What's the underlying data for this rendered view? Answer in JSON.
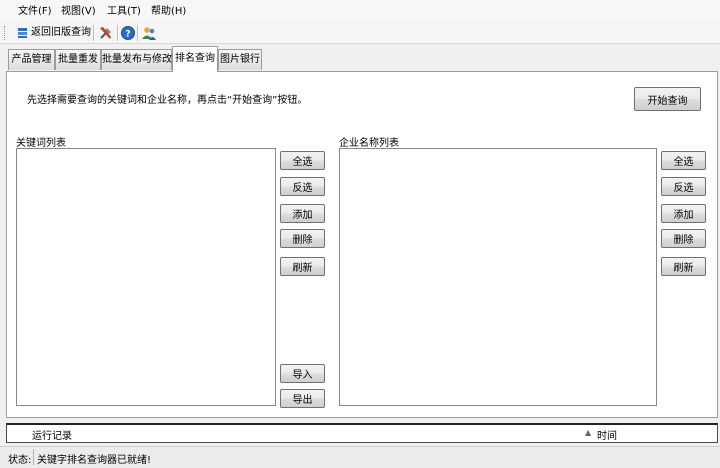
{
  "menu": {
    "items": [
      {
        "label": "文件(F)"
      },
      {
        "label": "视图(V)"
      },
      {
        "label": "工具(T)"
      },
      {
        "label": "帮助(H)"
      }
    ]
  },
  "toolbar": {
    "back_label": "返回旧版查询",
    "icons": [
      "return-icon",
      "tools-icon",
      "help-icon",
      "users-icon"
    ]
  },
  "tabs": [
    {
      "label": "产品管理",
      "active": false
    },
    {
      "label": "批量重发",
      "active": false
    },
    {
      "label": "批量发布与修改",
      "active": false
    },
    {
      "label": "排名查询",
      "active": true
    },
    {
      "label": "图片银行",
      "active": false
    }
  ],
  "rank_query": {
    "instruction": "先选择需要查询的关键词和企业名称，再点击“开始查询”按钮。",
    "start_button": "开始查询",
    "keywords": {
      "title": "关键词列表",
      "buttons": {
        "select_all": "全选",
        "invert": "反选",
        "add": "添加",
        "delete": "删除",
        "refresh": "刷新",
        "import": "导入",
        "export": "导出"
      }
    },
    "companies": {
      "title": "企业名称列表",
      "buttons": {
        "select_all": "全选",
        "invert": "反选",
        "add": "添加",
        "delete": "删除",
        "refresh": "刷新"
      }
    }
  },
  "log": {
    "col_record": "运行记录",
    "col_time": "时间",
    "sort_indicator": "▲"
  },
  "status": {
    "label": "状态:",
    "message": "关键字排名查询器已就绪!"
  }
}
